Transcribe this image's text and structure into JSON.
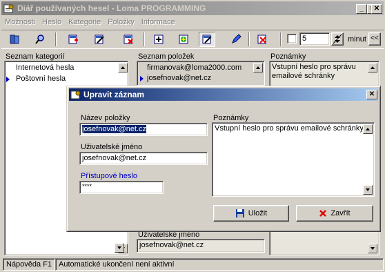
{
  "window": {
    "title": "Diář používaných hesel - Loma PROGRAMMING",
    "controls": {
      "minimize": "_",
      "maximize": "□",
      "close": "✕"
    }
  },
  "menu": [
    "Možnosti",
    "Heslo",
    "Kategorie",
    "Položky",
    "Informace"
  ],
  "toolbar": {
    "icons": [
      "books-icon",
      "magnifier-icon",
      "add-category-icon",
      "edit-category-icon",
      "delete-category-icon",
      "add-item-icon",
      "import-icon",
      "edit-item-icon",
      "pencil-icon",
      "delete-item-icon"
    ],
    "pressed": "edit-item-icon",
    "timer_value": "5",
    "timer_unit": "minut",
    "collapse": "<<"
  },
  "categories": {
    "label": "Seznam kategorií",
    "items": [
      "Internetová hesla",
      "Poštovní hesla"
    ],
    "selected": 1
  },
  "items": {
    "label": "Seznam položek",
    "rows": [
      "firmanovak@loma2000.com",
      "josefnovak@net.cz"
    ],
    "selected": 1
  },
  "notes_panel": {
    "label": "Poznámky",
    "text": "Vstupní heslo pro správu emailové schránky"
  },
  "detail": {
    "username_label": "Uživatelské jméno",
    "username_value": "josefnovak@net.cz"
  },
  "status": {
    "help": "Nápověda F1",
    "auto_logout": "Automatické ukončení není aktivní"
  },
  "dialog": {
    "title": "Upravit záznam",
    "close": "✕",
    "name_label": "Název položky",
    "name_value": "josefnovak@net.cz",
    "user_label": "Uživatelské jméno",
    "user_value": "josefnovak@net.cz",
    "password_label": "Přístupové heslo",
    "password_value": "****",
    "notes_label": "Poznámky",
    "notes_value": "Vstupní heslo pro správu emailové schránky",
    "save_label": "Uložit",
    "close_label": "Zavřít"
  },
  "colors": {
    "accent_blue": "#0a246a",
    "link_blue": "#0000c0",
    "inactive_title": "#808080"
  }
}
